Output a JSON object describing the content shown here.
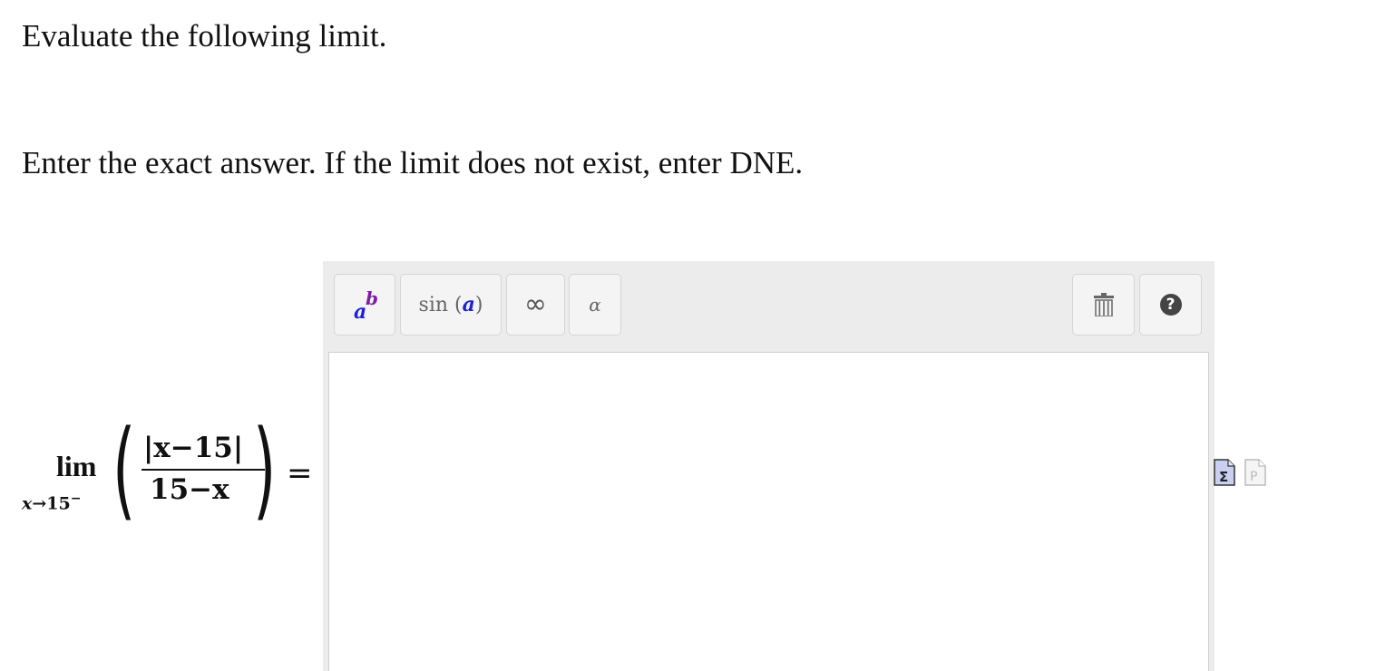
{
  "question": {
    "prompt": "Evaluate the following limit.",
    "instructions": "Enter the exact answer. If the limit does not exist, enter DNE."
  },
  "expression": {
    "lim": "lim",
    "subscript_var": "x",
    "subscript_arrow": "→15",
    "subscript_side": "−",
    "numerator": "|x−15|",
    "denominator": "15−x",
    "equals": "="
  },
  "editor": {
    "toolbar": {
      "power": {
        "base": "a",
        "exponent": "b"
      },
      "trig": {
        "fn": "sin",
        "arg": "a"
      },
      "infinity": "∞",
      "greek": "α"
    },
    "answer_value": ""
  },
  "icons": {
    "power_button": "superscript-icon",
    "trig_button": "trig-function-icon",
    "infinity_button": "infinity-icon",
    "greek_button": "greek-letter-icon",
    "trash_button": "trash-icon",
    "help_button": "help-icon",
    "mathml": "mathml-sigma-icon",
    "preview": "preview-document-icon"
  },
  "colors": {
    "toolbar_bg": "#ececec",
    "variable_blue": "#1e22d6",
    "exponent_purple": "#7b1fa2"
  }
}
